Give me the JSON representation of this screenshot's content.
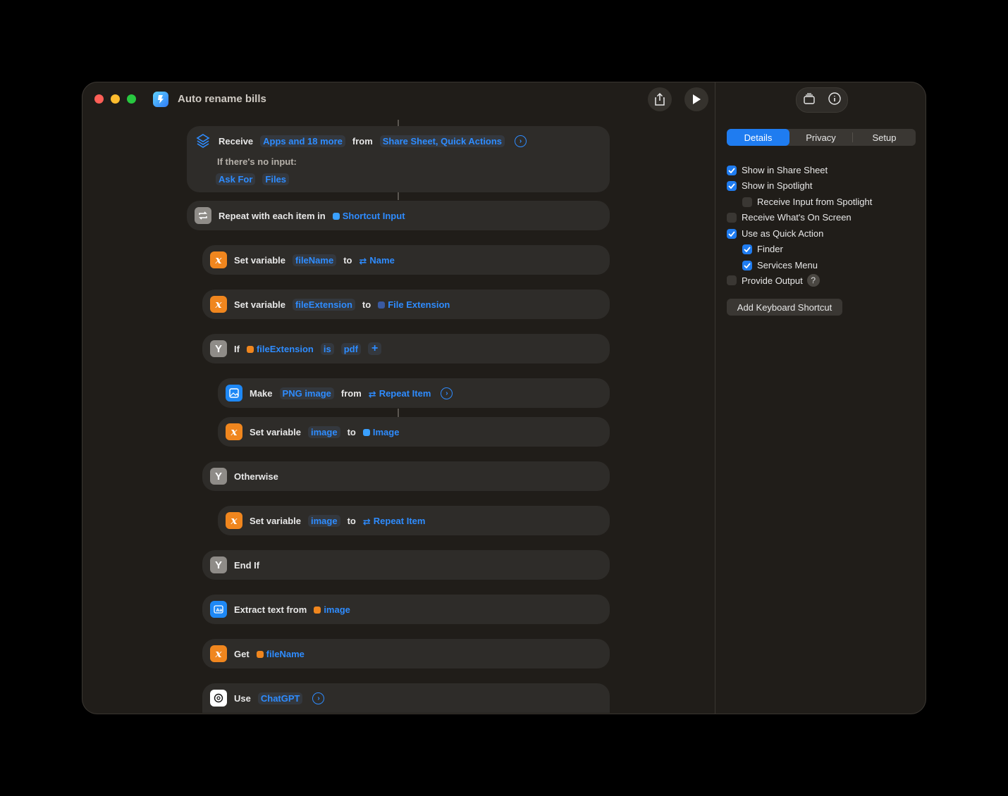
{
  "window": {
    "title": "Auto rename bills"
  },
  "workflow": {
    "receive": {
      "label": "Receive",
      "types": "Apps and 18 more",
      "from": "from",
      "sources": "Share Sheet, Quick Actions",
      "no_input_label": "If there's no input:",
      "ask_for": "Ask For",
      "files": "Files"
    },
    "repeat": {
      "label": "Repeat with each item in",
      "input": "Shortcut Input"
    },
    "set1": {
      "label": "Set variable",
      "var": "fileName",
      "to": "to",
      "value": "Name"
    },
    "set2": {
      "label": "Set variable",
      "var": "fileExtension",
      "to": "to",
      "value": "File Extension"
    },
    "if": {
      "label": "If",
      "var": "fileExtension",
      "op": "is",
      "value": "pdf",
      "add": "+"
    },
    "make": {
      "label": "Make",
      "type": "PNG image",
      "from": "from",
      "src": "Repeat Item"
    },
    "set3": {
      "label": "Set variable",
      "var": "image",
      "to": "to",
      "value": "Image"
    },
    "otherwise": {
      "label": "Otherwise"
    },
    "set4": {
      "label": "Set variable",
      "var": "image",
      "to": "to",
      "value": "Repeat Item"
    },
    "endif": {
      "label": "End If"
    },
    "extract": {
      "label": "Extract text from",
      "var": "image"
    },
    "get": {
      "label": "Get",
      "var": "fileName"
    },
    "use": {
      "label": "Use",
      "app": "ChatGPT"
    }
  },
  "panel": {
    "tabs": [
      "Details",
      "Privacy",
      "Setup"
    ],
    "options": [
      {
        "label": "Show in Share Sheet",
        "checked": true
      },
      {
        "label": "Show in Spotlight",
        "checked": true
      },
      {
        "label": "Receive Input from Spotlight",
        "checked": false
      },
      {
        "label": "Receive What's On Screen",
        "checked": false
      },
      {
        "label": "Use as Quick Action",
        "checked": true
      },
      {
        "label": "Finder",
        "checked": true
      },
      {
        "label": "Services Menu",
        "checked": true
      },
      {
        "label": "Provide Output",
        "checked": false
      }
    ],
    "help": "?",
    "keyboard_shortcut_button": "Add Keyboard Shortcut"
  },
  "colors": {
    "accent": "#1f7cf0",
    "token": "#2e8cff",
    "variable": "#f0861e",
    "background": "#201d19",
    "block": "#2e2c29"
  }
}
